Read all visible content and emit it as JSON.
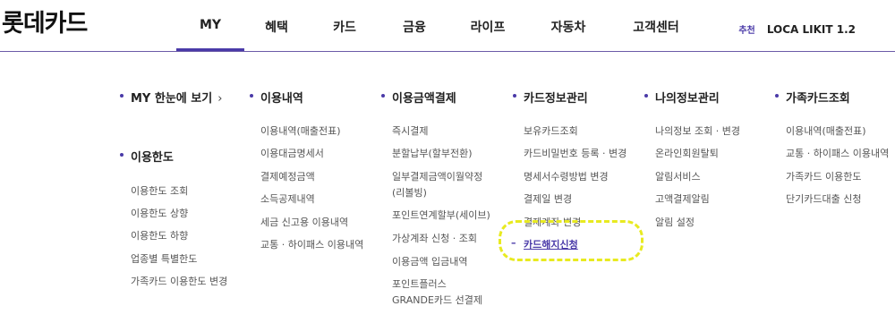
{
  "brand": {
    "logo_text": "롯데카드"
  },
  "gnb": {
    "items": [
      {
        "label": "MY",
        "active": true
      },
      {
        "label": "혜택"
      },
      {
        "label": "카드"
      },
      {
        "label": "금융"
      },
      {
        "label": "라이프"
      },
      {
        "label": "자동차"
      },
      {
        "label": "고객센터"
      }
    ],
    "recommend_label": "추천",
    "loca_label": "LOCA LIKIT 1.2"
  },
  "colors": {
    "accent": "#4a3aa8",
    "highlight_box": "#e8ea20"
  },
  "menu": {
    "columns": [
      {
        "groups": [
          {
            "title": "MY 한눈에 보기",
            "chevron": "›",
            "items": []
          },
          {
            "title": "이용한도",
            "items": [
              "이용한도 조회",
              "이용한도 상향",
              "이용한도 하향",
              "업종별 특별한도",
              "가족카드 이용한도 변경"
            ]
          }
        ]
      },
      {
        "groups": [
          {
            "title": "이용내역",
            "items": [
              "이용내역(매출전표)",
              "이용대금명세서",
              "결제예정금액",
              "소득공제내역",
              "세금 신고용 이용내역",
              "교통 · 하이패스 이용내역"
            ]
          }
        ]
      },
      {
        "groups": [
          {
            "title": "이용금액결제",
            "items": [
              "즉시결제",
              "분할납부(할부전환)",
              "일부결제금액이월약정",
              "(리볼빙)",
              "포인트연계할부(세이브)",
              "가상계좌 신청 · 조회",
              "이용금액 입금내역",
              "포인트플러스",
              "GRANDE카드 선결제"
            ]
          }
        ]
      },
      {
        "groups": [
          {
            "title": "카드정보관리",
            "items": [
              "보유카드조회",
              "카드비밀번호 등록 · 변경",
              "명세서수령방법 변경",
              "결제일 변경",
              "결제계좌 변경",
              "카드해지신청"
            ]
          }
        ]
      },
      {
        "groups": [
          {
            "title": "나의정보관리",
            "items": [
              "나의정보 조회 · 변경",
              "온라인회원탈퇴",
              "알림서비스",
              "고액결제알림",
              "알림 설정"
            ]
          }
        ]
      },
      {
        "groups": [
          {
            "title": "가족카드조회",
            "items": [
              "이용내역(매출전표)",
              "교통 · 하이패스 이용내역",
              "가족카드 이용한도",
              "단기카드대출 신청"
            ]
          }
        ]
      }
    ]
  }
}
